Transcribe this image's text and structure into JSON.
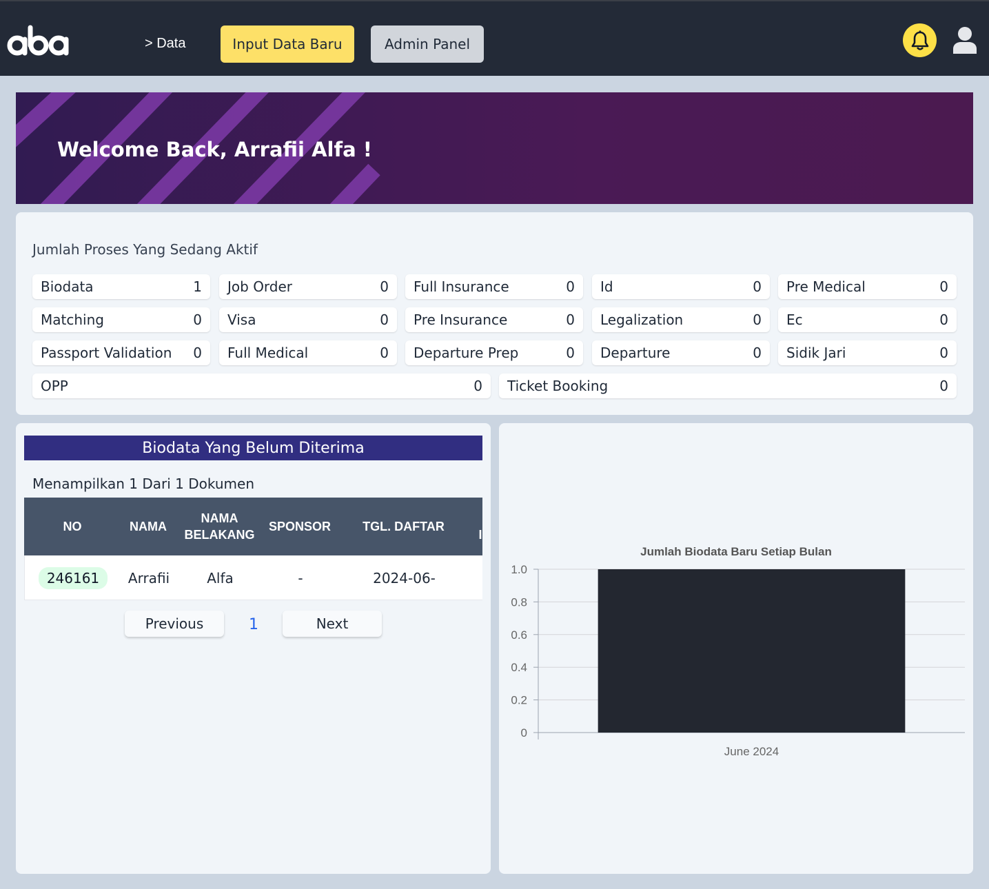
{
  "nav": {
    "breadcrumb": "> Data",
    "input_button": "Input Data Baru",
    "admin_button": "Admin Panel"
  },
  "banner": {
    "welcome": "Welcome Back, Arrafii Alfa !"
  },
  "process": {
    "title": "Jumlah Proses Yang Sedang Aktif",
    "items": [
      {
        "label": "Biodata",
        "count": "1"
      },
      {
        "label": "Job Order",
        "count": "0"
      },
      {
        "label": "Full Insurance",
        "count": "0"
      },
      {
        "label": "Id",
        "count": "0"
      },
      {
        "label": "Pre Medical",
        "count": "0"
      },
      {
        "label": "Matching",
        "count": "0"
      },
      {
        "label": "Visa",
        "count": "0"
      },
      {
        "label": "Pre Insurance",
        "count": "0"
      },
      {
        "label": "Legalization",
        "count": "0"
      },
      {
        "label": "Ec",
        "count": "0"
      },
      {
        "label": "Passport Validation",
        "count": "0"
      },
      {
        "label": "Full Medical",
        "count": "0"
      },
      {
        "label": "Departure Prep",
        "count": "0"
      },
      {
        "label": "Departure",
        "count": "0"
      },
      {
        "label": "Sidik Jari",
        "count": "0"
      },
      {
        "label": "OPP",
        "count": "0"
      },
      {
        "label": "Ticket Booking",
        "count": "0"
      }
    ]
  },
  "biodata_table": {
    "title": "Biodata Yang Belum Diterima",
    "showing": "Menampilkan 1 Dari 1 Dokumen",
    "columns": [
      "NO",
      "NAMA",
      "NAMA BELAKANG",
      "SPONSOR",
      "TGL. DAFTAR",
      "I"
    ],
    "rows": [
      {
        "no": "246161",
        "nama": "Arrafii",
        "nama_belakang": "Alfa",
        "sponsor": "-",
        "tgl_daftar": "2024-06-"
      }
    ],
    "pagination": {
      "previous": "Previous",
      "page": "1",
      "next": "Next"
    }
  },
  "chart_data": {
    "type": "bar",
    "title": "Jumlah Biodata Baru Setiap Bulan",
    "categories": [
      "June 2024"
    ],
    "values": [
      1
    ],
    "ylim": [
      0,
      1
    ],
    "yticks": [
      "0",
      "0.2",
      "0.4",
      "0.6",
      "0.8",
      "1.0"
    ],
    "grid": true,
    "xlabel": "",
    "ylabel": "",
    "bar_color": "#232730"
  },
  "colors": {
    "topbar": "#232a37",
    "accent_yellow": "#fde068",
    "table_title_bg": "#312e81",
    "table_head_bg": "#475569"
  }
}
